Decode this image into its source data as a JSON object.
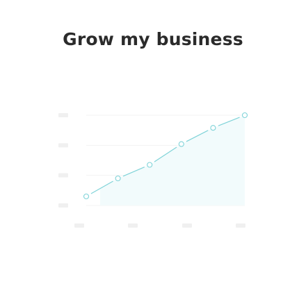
{
  "header": {
    "title": "Grow my business"
  },
  "chart_data": {
    "type": "line",
    "x": [
      1,
      2,
      3,
      4,
      5,
      6
    ],
    "values": [
      0.1,
      0.3,
      0.45,
      0.68,
      0.86,
      1.0
    ],
    "ylim": [
      0,
      1
    ],
    "grid": true,
    "line_color": "#7fd3d8",
    "area_color": "#f2fbfc",
    "placeholder_color": "#f0f0f0"
  }
}
